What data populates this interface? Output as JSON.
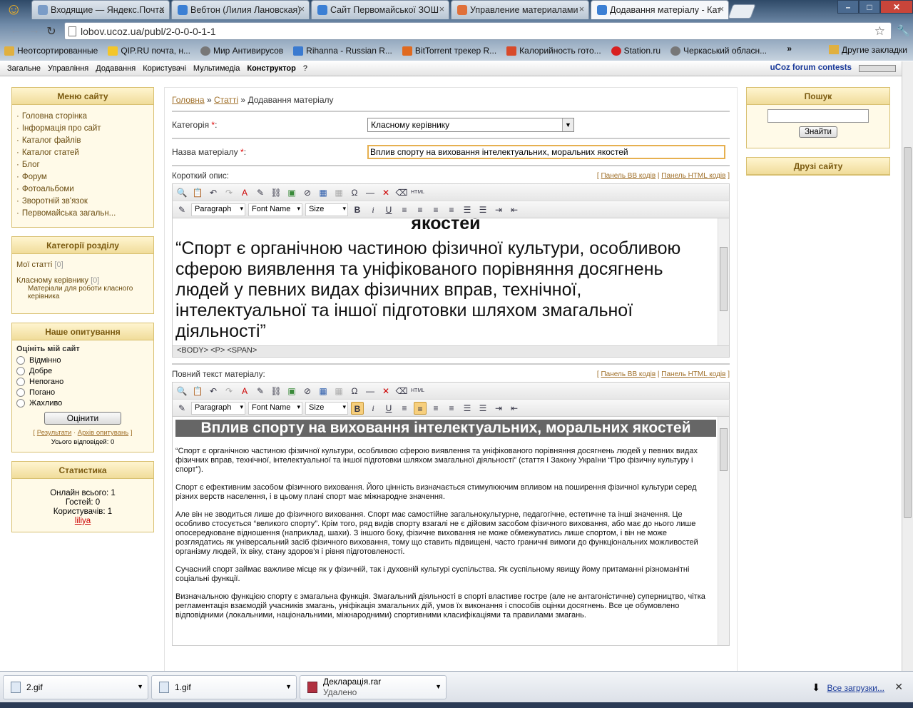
{
  "browser": {
    "tabs": [
      {
        "title": "Входящие — Яндекс.Почта"
      },
      {
        "title": "Вебтон (Лилия Лановская)"
      },
      {
        "title": "Сайт Первомайської ЗОШ"
      },
      {
        "title": "Управление материалами"
      },
      {
        "title": "Додавання матеріалу - Кат",
        "active": true
      }
    ],
    "url": "lobov.ucoz.ua/publ/2-0-0-0-1-1",
    "bookmarks": [
      {
        "label": "Неотсортированные"
      },
      {
        "label": "QIP.RU почта, н..."
      },
      {
        "label": "Мир Антивирусов"
      },
      {
        "label": "Rihanna - Russian R..."
      },
      {
        "label": "BitTorrent трекер R..."
      },
      {
        "label": "Калорийность гото..."
      },
      {
        "label": "Station.ru"
      },
      {
        "label": "Черкаський обласн..."
      }
    ],
    "bookmarks_more": "»",
    "bookmarks_other": "Другие закладки"
  },
  "ucoz_bar": {
    "items": [
      "Загальне",
      "Управління",
      "Додавання",
      "Користувачі",
      "Мультимедіа",
      "Конструктор",
      "?"
    ],
    "contest": "uCoz forum contests"
  },
  "left": {
    "menu_title": "Меню сайту",
    "menu_items": [
      "Головна сторінка",
      "Інформація про сайт",
      "Каталог файлів",
      "Каталог статей",
      "Блог",
      "Форум",
      "Фотоальбоми",
      "Зворотній зв'язок",
      "Первомайська загальн..."
    ],
    "cats_title": "Категорії розділу",
    "cats": [
      {
        "name": "Мої статті",
        "count": "[0]",
        "desc": ""
      },
      {
        "name": "Класному керівнику",
        "count": "[0]",
        "desc": "Матеріали для роботи класного керівника"
      }
    ],
    "poll_title": "Наше опитування",
    "poll_question": "Оцініть мій сайт",
    "poll_options": [
      "Відмінно",
      "Добре",
      "Непогано",
      "Погано",
      "Жахливо"
    ],
    "poll_button": "Оцінити",
    "poll_results": "Результати",
    "poll_archive": "Архів опитувань",
    "poll_total": "Усього відповідей: 0",
    "stats_title": "Статистика",
    "stats_online": "Онлайн всього: 1",
    "stats_guests": "Гостей: 0",
    "stats_users": "Користувачів: 1",
    "stats_user": "liliya"
  },
  "right": {
    "search_title": "Пошук",
    "search_button": "Знайти",
    "friends_title": "Друзі сайту"
  },
  "center": {
    "crumb_home": "Головна",
    "crumb_sep": "»",
    "crumb_section": "Статті",
    "crumb_current": "Додавання матеріалу",
    "category_label": "Категорія",
    "category_value": "Класному керівнику",
    "title_label": "Назва матеріалу",
    "title_value": "Вплив спорту на виховання інтелектуальних, моральних якостей",
    "short_label": "Короткий опис:",
    "bb_panel": "Панель BB кодів",
    "html_panel": "Панель HTML кодів",
    "full_label": "Повний текст матеріалу:",
    "dd_paragraph": "Paragraph",
    "dd_font": "Font Name",
    "dd_size": "Size",
    "short_heading_tail": "якостей",
    "short_quote": "“Спорт є органічною частиною фізичної культури, особливою сферою виявлення та уніфікованого порівняння досягнень людей у певних видах фізичних вправ, технічної, інтелектуальної та іншої підготовки шляхом змагальної діяльності”",
    "short_status": "<BODY>  <P>  <SPAN>",
    "full_heading": "Вплив спорту на виховання інтелектуальних, моральних якостей",
    "paragraphs": [
      "“Спорт є органічною частиною фізичної культури, особливою сферою виявлення та уніфікованого порівняння досягнень людей у певних видах фізичних вправ, технічної, інтелектуальної та іншої підготовки шляхом змагальної діяльності” (стаття I Закону України “Про фізичну культуру і спорт”).",
      "Спорт є ефективним засобом фізичного виховання. Його цінність визначається стимулюючим впливом на поширення фізичної культури серед різних верств населення, і в цьому плані спорт має міжнародне значення.",
      "Але він не зводиться лише до фізичного виховання. Спорт має самостійне загальнокультурне, педагогічне, естетичне та інші значення. Це особливо стосується “великого спорту”. Крім того, ряд видів спорту взагалі не є дійовим засобом фізичного виховання, або має до нього лише опосередковане відношення (наприклад, шахи). З іншого боку, фізичне виховання не може обмежуватись лише спортом, і він не може розглядатись як універсальний засіб фізичного виховання, тому що ставить підвищені, часто граничні вимоги до функціональних можливостей організму людей, їх віку, стану здоров’я і рівня підготовленості.",
      "Сучасний спорт займає важливе місце як у фізичній, так і духовній культурі суспільства. Як суспільному явищу йому притаманні різноманітні соціальні функції.",
      "Визначальною функцією спорту є змагальна функція. Змагальний діяльності в спорті властиве гостре (але не антагоністичне) суперництво, чітка регламентація взаємодій учасників змагань, уніфікація змагальних дій, умов їх виконання і способів оцінки досягнень. Все це обумовлено відповідними (локальними, національними, міжнародними) спортивними класифікаціями та правилами змагань."
    ]
  },
  "downloads": {
    "items": [
      {
        "name": "2.gif",
        "sub": ""
      },
      {
        "name": "1.gif",
        "sub": ""
      },
      {
        "name": "Декларація.rar",
        "sub": "Удалено"
      }
    ],
    "all": "Все загрузки...",
    "close": "✕"
  }
}
